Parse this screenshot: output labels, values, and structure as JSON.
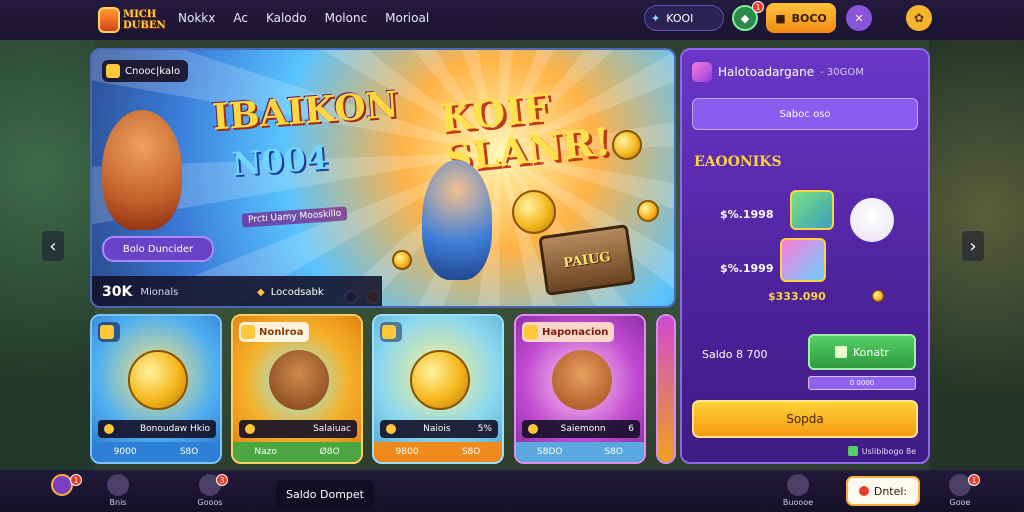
{
  "header": {
    "logo_line1": "MICH",
    "logo_line2": "DUBEN",
    "nav": [
      "Nokkx",
      "Ac",
      "Kalodo",
      "Molonc",
      "Morioal"
    ],
    "coins": "KOOI",
    "gems_badge": "1",
    "gold": "BOCO"
  },
  "hero": {
    "tag": "Cnooc|kalo",
    "title_a": "IBAIKON",
    "title_b": "N004",
    "subtitle": "Prcti Uamy Mooskillo",
    "title_c_line1": "KOIF",
    "title_c_line2": "SLANR!",
    "chest_label": "PAIUG",
    "button": "Bolo Duncider",
    "stat_value": "30K",
    "stat_label": "Mionals",
    "promo": "Locodsabk"
  },
  "cards": [
    {
      "title": "",
      "label": "Bonoudaw Hkio",
      "foot_a": "9000",
      "foot_b": "S8O",
      "theme": "#3c8fe6"
    },
    {
      "title": "Nonlroa",
      "label": "Salaiuac",
      "foot_a": "Nazo",
      "foot_b": "Ø8O",
      "theme": "#f0a020"
    },
    {
      "title": "",
      "label": "Naiois",
      "value": "5%",
      "foot_a": "9800",
      "foot_b": "S8O",
      "theme": "#5cc0e0"
    },
    {
      "title": "Haponacion",
      "label": "Saiemonn",
      "value": "6",
      "foot_a": "S8DO",
      "foot_b": "S8O",
      "theme": "#b040c0"
    }
  ],
  "side": {
    "title": "Halotoadargane",
    "title_note": "- 30GOM",
    "search": "Saboc oso",
    "section": "EAOONIKS",
    "price1": "$%.1998",
    "price2": "$%.1999",
    "price3": "$333.090",
    "balance": "Saldo 8 700",
    "green_button": "Konatr",
    "small_bar": "0 0000",
    "cta": "Sopda",
    "footnote": "Uslibibogo 8e"
  },
  "bottom": {
    "nav_badge": "1",
    "nav1": "Bnis",
    "nav2": "Gooos",
    "games_badge": "3",
    "wallet": "Saldo Dompet",
    "nav3": "Buoooe",
    "detail": "Dntel:",
    "nav4": "Gooe",
    "nav4_badge": "1"
  }
}
